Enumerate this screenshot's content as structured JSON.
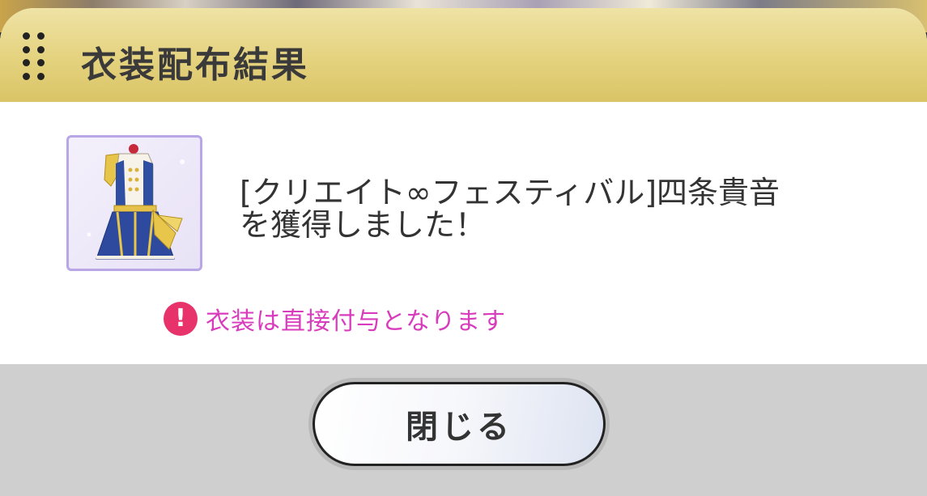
{
  "dialog": {
    "title": "衣装配布結果",
    "message_line1": "[クリエイト∞フェスティバル]四条貴音",
    "message_line2": "を獲得しました！",
    "notice_icon": "!",
    "notice": "衣装は直接付与となります",
    "close_label": "閉じる"
  },
  "icons": {
    "grip": "drag-handle-icon",
    "notice": "exclamation-icon"
  },
  "colors": {
    "header": "#e4d27e",
    "notice_text": "#d83cbd",
    "notice_icon": "#e8326a",
    "footer": "#cfcfcf"
  }
}
